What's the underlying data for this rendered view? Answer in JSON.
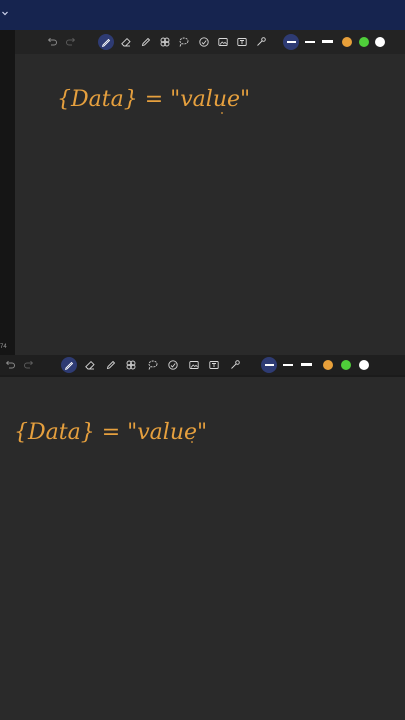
{
  "app": {
    "page_indicator": "74"
  },
  "handwriting": {
    "text": "{Data} = \"value\""
  },
  "colors": {
    "topbar": "#16244f",
    "canvas": "#2a2a2a",
    "ink": "#e6a03e",
    "swatch_orange": "#e8a03a",
    "swatch_green": "#4fcf3a",
    "swatch_white": "#ffffff",
    "active_tool_bg": "#2e3b73"
  },
  "toolbar": {
    "tools": [
      "undo-icon",
      "redo-icon",
      "pen-icon",
      "eraser-icon",
      "highlighter-icon",
      "lasso-icon",
      "shape-icon",
      "sticker-icon",
      "image-icon",
      "text-icon",
      "laser-pointer-icon"
    ],
    "active_tool": "pen-icon",
    "stroke_widths": [
      "thin",
      "medium",
      "thick"
    ],
    "colors": [
      "#e8a03a",
      "#4fcf3a",
      "#ffffff"
    ]
  }
}
